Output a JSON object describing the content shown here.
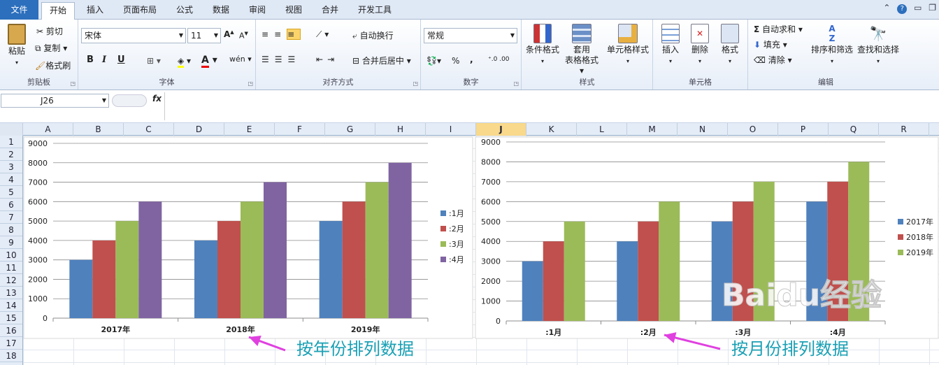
{
  "tabs": [
    "文件",
    "开始",
    "插入",
    "页面布局",
    "公式",
    "数据",
    "审阅",
    "视图",
    "合并",
    "开发工具"
  ],
  "ribbon": {
    "clipboard": {
      "paste": "粘贴",
      "cut": "剪切",
      "copy": "复制",
      "format_painter": "格式刷",
      "label": "剪贴板"
    },
    "font": {
      "name": "宋体",
      "size": "11",
      "label": "字体",
      "bold": "B",
      "italic": "I",
      "underline": "U"
    },
    "align": {
      "wrap": "自动换行",
      "merge": "合并后居中",
      "label": "对齐方式"
    },
    "number": {
      "format": "常规",
      "percent": "%",
      "comma": ",",
      "label": "数字"
    },
    "styles": {
      "cond": "条件格式",
      "table1": "套用",
      "table2": "表格格式",
      "cell": "单元格样式",
      "label": "样式"
    },
    "cells": {
      "insert": "插入",
      "delete": "删除",
      "format": "格式",
      "label": "单元格"
    },
    "edit": {
      "autosum": "自动求和",
      "fill": "填充",
      "clear": "清除",
      "sort": "排序和筛选",
      "find": "查找和选择",
      "label": "编辑"
    }
  },
  "formula_bar": {
    "name_box": "J26",
    "fx": "fx"
  },
  "columns": [
    "A",
    "B",
    "C",
    "D",
    "E",
    "F",
    "G",
    "H",
    "I",
    "J",
    "K",
    "L",
    "M",
    "N",
    "O",
    "P",
    "Q",
    "R"
  ],
  "rows": [
    "1",
    "2",
    "3",
    "4",
    "5",
    "6",
    "7",
    "8",
    "9",
    "10",
    "11",
    "12",
    "13",
    "14",
    "15",
    "16",
    "17",
    "18"
  ],
  "chart_data": [
    {
      "type": "bar",
      "categories": [
        "2017年",
        "2018年",
        "2019年"
      ],
      "series": [
        {
          "name": ":1月",
          "values": [
            3000,
            4000,
            5000
          ]
        },
        {
          "name": ":2月",
          "values": [
            4000,
            5000,
            6000
          ]
        },
        {
          "name": ":3月",
          "values": [
            5000,
            6000,
            7000
          ]
        },
        {
          "name": ":4月",
          "values": [
            6000,
            7000,
            8000
          ]
        }
      ],
      "ylim": [
        0,
        9000
      ],
      "yticks": [
        0,
        1000,
        2000,
        3000,
        4000,
        5000,
        6000,
        7000,
        8000,
        9000
      ],
      "legend": "right"
    },
    {
      "type": "bar",
      "categories": [
        ":1月",
        ":2月",
        ":3月",
        ":4月"
      ],
      "series": [
        {
          "name": "2017年",
          "values": [
            3000,
            4000,
            5000,
            6000
          ]
        },
        {
          "name": "2018年",
          "values": [
            4000,
            5000,
            6000,
            7000
          ]
        },
        {
          "name": "2019年",
          "values": [
            5000,
            6000,
            7000,
            8000
          ]
        }
      ],
      "ylim": [
        0,
        9000
      ],
      "yticks": [
        0,
        1000,
        2000,
        3000,
        4000,
        5000,
        6000,
        7000,
        8000,
        9000
      ],
      "legend": "right"
    }
  ],
  "colors": {
    "blue": "#4f81bd",
    "red": "#c0504d",
    "green": "#9bbb59",
    "purple": "#8064a2",
    "annot": "#1aa0b4",
    "arrow": "#e040e0"
  },
  "annotations": {
    "left": "按年份排列数据",
    "right": "按月份排列数据"
  },
  "watermark": "Baidu经验"
}
